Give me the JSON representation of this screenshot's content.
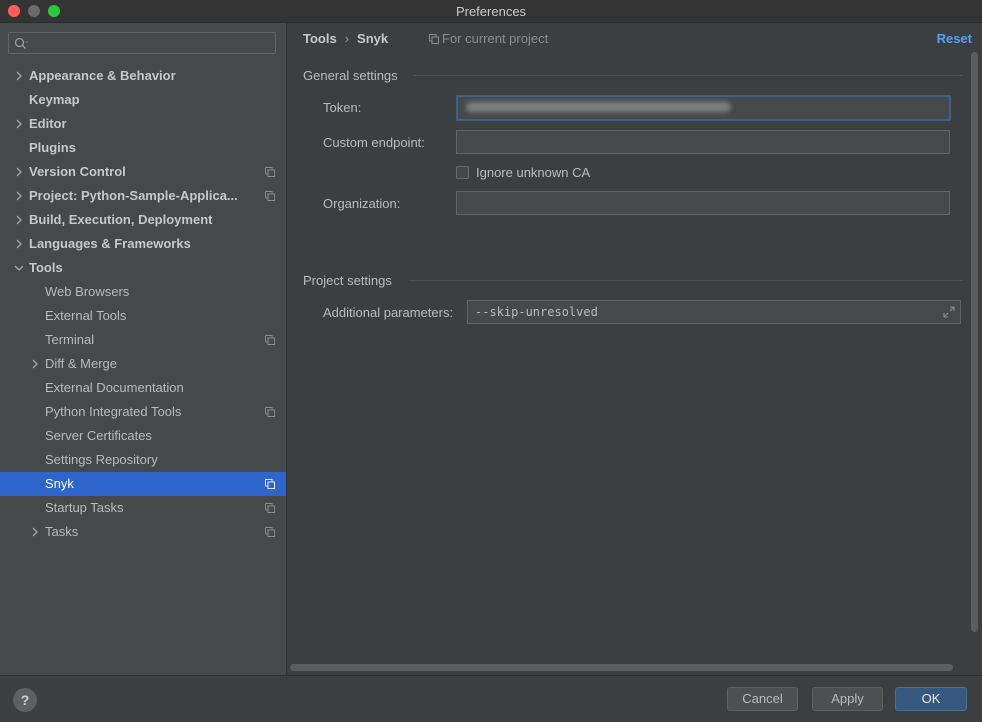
{
  "window": {
    "title": "Preferences"
  },
  "sidebar": {
    "search": {
      "value": "",
      "placeholder": ""
    },
    "items": [
      {
        "label": "Appearance & Behavior",
        "level": 0,
        "expandable": true,
        "expanded": false,
        "project_icon": false
      },
      {
        "label": "Keymap",
        "level": 0,
        "expandable": false,
        "project_icon": false
      },
      {
        "label": "Editor",
        "level": 0,
        "expandable": true,
        "expanded": false,
        "project_icon": false
      },
      {
        "label": "Plugins",
        "level": 0,
        "expandable": false,
        "project_icon": false
      },
      {
        "label": "Version Control",
        "level": 0,
        "expandable": true,
        "expanded": false,
        "project_icon": true
      },
      {
        "label": "Project: Python-Sample-Applica...",
        "level": 0,
        "expandable": true,
        "expanded": false,
        "project_icon": true
      },
      {
        "label": "Build, Execution, Deployment",
        "level": 0,
        "expandable": true,
        "expanded": false,
        "project_icon": false
      },
      {
        "label": "Languages & Frameworks",
        "level": 0,
        "expandable": true,
        "expanded": false,
        "project_icon": false
      },
      {
        "label": "Tools",
        "level": 0,
        "expandable": true,
        "expanded": true,
        "project_icon": false
      },
      {
        "label": "Web Browsers",
        "level": 1,
        "expandable": false,
        "project_icon": false
      },
      {
        "label": "External Tools",
        "level": 1,
        "expandable": false,
        "project_icon": false
      },
      {
        "label": "Terminal",
        "level": 1,
        "expandable": false,
        "project_icon": true
      },
      {
        "label": "Diff & Merge",
        "level": 1,
        "expandable": true,
        "expanded": false,
        "project_icon": false
      },
      {
        "label": "External Documentation",
        "level": 1,
        "expandable": false,
        "project_icon": false
      },
      {
        "label": "Python Integrated Tools",
        "level": 1,
        "expandable": false,
        "project_icon": true
      },
      {
        "label": "Server Certificates",
        "level": 1,
        "expandable": false,
        "project_icon": false
      },
      {
        "label": "Settings Repository",
        "level": 1,
        "expandable": false,
        "project_icon": false
      },
      {
        "label": "Snyk",
        "level": 1,
        "expandable": false,
        "project_icon": true,
        "selected": true
      },
      {
        "label": "Startup Tasks",
        "level": 1,
        "expandable": false,
        "project_icon": true
      },
      {
        "label": "Tasks",
        "level": 1,
        "expandable": true,
        "expanded": false,
        "project_icon": true
      }
    ]
  },
  "main": {
    "breadcrumb": {
      "parent": "Tools",
      "separator": "›",
      "current": "Snyk"
    },
    "for_current_project": "For current project",
    "reset_label": "Reset",
    "general": {
      "title": "General settings",
      "token_label": "Token:",
      "token_value_blurred": true,
      "endpoint_label": "Custom endpoint:",
      "endpoint_value": "",
      "ignore_ca_label": "Ignore unknown CA",
      "ignore_ca_checked": false,
      "organization_label": "Organization:",
      "organization_value": ""
    },
    "project": {
      "title": "Project settings",
      "params_label": "Additional parameters:",
      "params_value": "--skip-unresolved"
    }
  },
  "footer": {
    "help_label": "?",
    "cancel_label": "Cancel",
    "apply_label": "Apply",
    "ok_label": "OK"
  },
  "colors": {
    "accent": "#589df6",
    "selection": "#2f65ca",
    "primary_button": "#365880",
    "background": "#3c3f41",
    "sidebar_background": "#45494a"
  },
  "icons": {
    "search": "search-icon",
    "chevron_right": "chevron-right-icon",
    "chevron_down": "chevron-down-icon",
    "project_level": "project-scope-icon",
    "expand": "expand-icon"
  }
}
